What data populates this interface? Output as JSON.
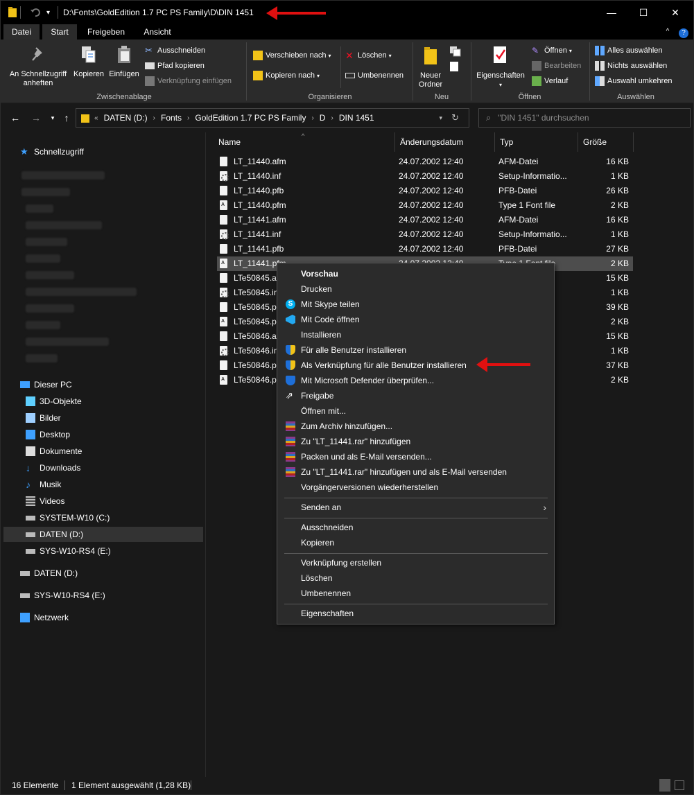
{
  "titlebar": {
    "path": "D:\\Fonts\\GoldEdition 1.7 PC PS Family\\D\\DIN 1451",
    "minimize": "—",
    "maximize": "☐",
    "close": "✕"
  },
  "ribbon_tabs": [
    "Datei",
    "Start",
    "Freigeben",
    "Ansicht"
  ],
  "ribbon": {
    "pin_label_1": "An Schnellzugriff",
    "pin_label_2": "anheften",
    "copy": "Kopieren",
    "paste": "Einfügen",
    "cut": "Ausschneiden",
    "copy_path": "Pfad kopieren",
    "paste_shortcut": "Verknüpfung einfügen",
    "group_clipboard": "Zwischenablage",
    "move_to": "Verschieben nach",
    "copy_to": "Kopieren nach",
    "delete": "Löschen",
    "rename": "Umbenennen",
    "group_organize": "Organisieren",
    "new_folder_1": "Neuer",
    "new_folder_2": "Ordner",
    "group_new": "Neu",
    "properties": "Eigenschaften",
    "open": "Öffnen",
    "edit": "Bearbeiten",
    "history": "Verlauf",
    "group_open": "Öffnen",
    "select_all": "Alles auswählen",
    "select_none": "Nichts auswählen",
    "invert_selection": "Auswahl umkehren",
    "group_select": "Auswählen"
  },
  "address": {
    "crumbs": [
      "DATEN (D:)",
      "Fonts",
      "GoldEdition 1.7 PC PS Family",
      "D",
      "DIN 1451"
    ],
    "search_placeholder": "\"DIN 1451\" durchsuchen"
  },
  "sidebar": {
    "quick_access": "Schnellzugriff",
    "this_pc": "Dieser PC",
    "pc_items": [
      "3D-Objekte",
      "Bilder",
      "Desktop",
      "Dokumente",
      "Downloads",
      "Musik",
      "Videos",
      "SYSTEM-W10 (C:)",
      "DATEN (D:)",
      "SYS-W10-RS4 (E:)"
    ],
    "drive_d": "DATEN (D:)",
    "drive_e": "SYS-W10-RS4 (E:)",
    "network": "Netzwerk"
  },
  "columns": {
    "name": "Name",
    "date": "Änderungsdatum",
    "type": "Typ",
    "size": "Größe"
  },
  "files": [
    {
      "name": "LT_11440.afm",
      "date": "24.07.2002 12:40",
      "type": "AFM-Datei",
      "size": "16 KB"
    },
    {
      "name": "LT_11440.inf",
      "date": "24.07.2002 12:40",
      "type": "Setup-Informatio...",
      "size": "1 KB"
    },
    {
      "name": "LT_11440.pfb",
      "date": "24.07.2002 12:40",
      "type": "PFB-Datei",
      "size": "26 KB"
    },
    {
      "name": "LT_11440.pfm",
      "date": "24.07.2002 12:40",
      "type": "Type 1 Font file",
      "size": "2 KB"
    },
    {
      "name": "LT_11441.afm",
      "date": "24.07.2002 12:40",
      "type": "AFM-Datei",
      "size": "16 KB"
    },
    {
      "name": "LT_11441.inf",
      "date": "24.07.2002 12:40",
      "type": "Setup-Informatio...",
      "size": "1 KB"
    },
    {
      "name": "LT_11441.pfb",
      "date": "24.07.2002 12:40",
      "type": "PFB-Datei",
      "size": "27 KB"
    },
    {
      "name": "LT_11441.pfm",
      "date": "24.07.2002 12:40",
      "type": "Type 1 Font file",
      "size": "2 KB"
    },
    {
      "name": "LTe50845.afm",
      "date": "",
      "type": "",
      "size": "15 KB"
    },
    {
      "name": "LTe50845.inf",
      "date": "",
      "type": "io...",
      "size": "1 KB"
    },
    {
      "name": "LTe50845.pfb",
      "date": "",
      "type": "",
      "size": "39 KB"
    },
    {
      "name": "LTe50845.pfm",
      "date": "",
      "type": "",
      "size": "2 KB"
    },
    {
      "name": "LTe50846.afm",
      "date": "",
      "type": "",
      "size": "15 KB"
    },
    {
      "name": "LTe50846.inf",
      "date": "",
      "type": "io...",
      "size": "1 KB"
    },
    {
      "name": "LTe50846.pfb",
      "date": "",
      "type": "",
      "size": "37 KB"
    },
    {
      "name": "LTe50846.pfm",
      "date": "",
      "type": "",
      "size": "2 KB"
    }
  ],
  "context_menu": {
    "preview": "Vorschau",
    "print": "Drucken",
    "skype": "Mit Skype teilen",
    "code": "Mit Code öffnen",
    "install": "Installieren",
    "install_all": "Für alle Benutzer installieren",
    "install_link_all": "Als Verknüpfung für alle Benutzer installieren",
    "defender": "Mit Microsoft Defender überprüfen...",
    "share": "Freigabe",
    "open_with": "Öffnen mit...",
    "archive_add": "Zum Archiv hinzufügen...",
    "rar_add": "Zu \"LT_11441.rar\" hinzufügen",
    "pack_email": "Packen und als E-Mail versenden...",
    "rar_email": "Zu \"LT_11441.rar\" hinzufügen und als E-Mail versenden",
    "restore": "Vorgängerversionen wiederherstellen",
    "send_to": "Senden an",
    "cut": "Ausschneiden",
    "copy": "Kopieren",
    "create_link": "Verknüpfung erstellen",
    "delete": "Löschen",
    "rename": "Umbenennen",
    "properties": "Eigenschaften"
  },
  "status": {
    "count": "16 Elemente",
    "selected": "1 Element ausgewählt (1,28 KB)"
  },
  "colors": {
    "accent": "#1e6fd9",
    "annotation_arrow": "#e01010",
    "folder": "#f2c318"
  }
}
